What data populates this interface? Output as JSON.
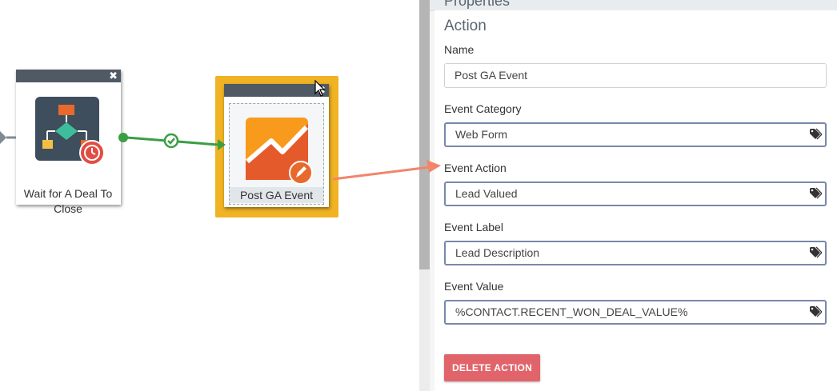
{
  "canvas": {
    "nodes": [
      {
        "label": "Wait for A Deal To Close",
        "icon": "flowchart-timer-icon"
      },
      {
        "label": "Post GA Event",
        "icon": "google-analytics-icon",
        "selected": true
      }
    ]
  },
  "properties": {
    "header": "Properties",
    "section_title": "Action",
    "fields": [
      {
        "label": "Name",
        "value": "Post GA Event"
      },
      {
        "label": "Event Category",
        "value": "Web Form",
        "icon": "tag-icon"
      },
      {
        "label": "Event Action",
        "value": "Lead Valued",
        "icon": "tag-icon"
      },
      {
        "label": "Event Label",
        "value": "Lead Description",
        "icon": "tag-icon"
      },
      {
        "label": "Event Value",
        "value": "%CONTACT.RECENT_WON_DEAL_VALUE%",
        "icon": "tag-icon"
      }
    ],
    "delete_label": "DELETE ACTION"
  },
  "colors": {
    "accent_green": "#3a9e44",
    "selection": "#f0b323",
    "annotation_arrow": "#f0866a",
    "delete": "#e2646b"
  }
}
